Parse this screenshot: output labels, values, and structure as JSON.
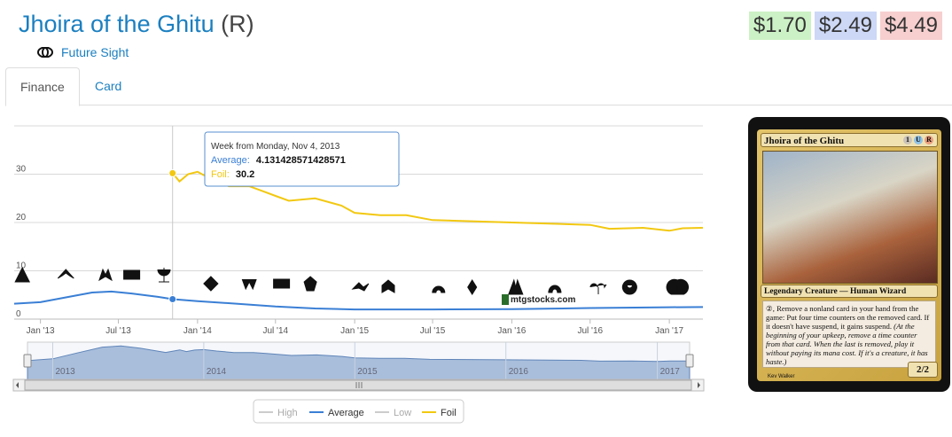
{
  "card": {
    "name": "Jhoira of the Ghitu",
    "rarity": "(R)",
    "set": "Future Sight",
    "set_icon": "future-sight-set-icon",
    "type_line": "Legendary Creature — Human Wizard",
    "rules_text": "②, Remove a nonland card in your hand from the game: Put four time counters on the removed card. If it doesn't have suspend, it gains suspend.",
    "reminder_text": "(At the beginning of your upkeep, remove a time counter from that card. When the last is removed, play it without paying its mana cost. If it's a creature, it has haste.)",
    "pt": "2/2",
    "mana_cost": [
      "1",
      "U",
      "R"
    ],
    "artist": "Kev Walker"
  },
  "prices": [
    "$1.70",
    "$2.49",
    "$4.49"
  ],
  "tabs": [
    {
      "label": "Finance",
      "active": true
    },
    {
      "label": "Card",
      "active": false
    }
  ],
  "chart_data": {
    "type": "line",
    "x_type": "date",
    "xlim": [
      "2012-11-01",
      "2017-03-20"
    ],
    "ylim": [
      0,
      40
    ],
    "yticks": [
      0,
      10,
      20,
      30
    ],
    "xticks": [
      "Jan '13",
      "Jul '13",
      "Jan '14",
      "Jul '14",
      "Jan '15",
      "Jul '15",
      "Jan '16",
      "Jul '16",
      "Jan '17"
    ],
    "xtick_dates": [
      "2013-01-01",
      "2013-07-01",
      "2014-01-01",
      "2014-07-01",
      "2015-01-01",
      "2015-07-01",
      "2016-01-01",
      "2016-07-01",
      "2017-01-01"
    ],
    "grid": true,
    "watermark": "mtgstocks.com",
    "series": [
      {
        "name": "Average",
        "color": "#3a7fd5",
        "points": [
          [
            "2012-11-01",
            3.2
          ],
          [
            "2013-01-01",
            3.5
          ],
          [
            "2013-03-01",
            4.5
          ],
          [
            "2013-05-01",
            5.5
          ],
          [
            "2013-06-15",
            5.7
          ],
          [
            "2013-08-01",
            5.3
          ],
          [
            "2013-10-01",
            4.6
          ],
          [
            "2013-11-04",
            4.13
          ],
          [
            "2014-01-01",
            3.7
          ],
          [
            "2014-04-01",
            3.2
          ],
          [
            "2014-07-01",
            2.6
          ],
          [
            "2014-10-01",
            2.2
          ],
          [
            "2015-01-01",
            2.0
          ],
          [
            "2015-07-01",
            2.0
          ],
          [
            "2016-01-01",
            2.05
          ],
          [
            "2016-07-01",
            2.3
          ],
          [
            "2017-01-01",
            2.45
          ],
          [
            "2017-03-20",
            2.5
          ]
        ]
      },
      {
        "name": "Foil",
        "color": "#f2c811",
        "points": [
          [
            "2013-11-04",
            30.2
          ],
          [
            "2013-11-20",
            28.5
          ],
          [
            "2013-12-10",
            30.0
          ],
          [
            "2014-01-01",
            30.5
          ],
          [
            "2014-02-01",
            29.0
          ],
          [
            "2014-03-15",
            27.5
          ],
          [
            "2014-05-01",
            27.5
          ],
          [
            "2014-06-01",
            26.5
          ],
          [
            "2014-07-01",
            25.5
          ],
          [
            "2014-08-01",
            24.5
          ],
          [
            "2014-10-01",
            25.0
          ],
          [
            "2014-12-01",
            23.5
          ],
          [
            "2015-01-01",
            22.0
          ],
          [
            "2015-03-01",
            21.5
          ],
          [
            "2015-05-01",
            21.5
          ],
          [
            "2015-07-01",
            20.5
          ],
          [
            "2016-01-01",
            20.0
          ],
          [
            "2016-07-01",
            19.5
          ],
          [
            "2016-08-15",
            18.7
          ],
          [
            "2016-11-01",
            18.9
          ],
          [
            "2017-01-01",
            18.3
          ],
          [
            "2017-02-01",
            18.8
          ],
          [
            "2017-03-20",
            18.9
          ]
        ]
      },
      {
        "name": "High",
        "color": "#cccccc",
        "points": []
      },
      {
        "name": "Low",
        "color": "#cccccc",
        "points": []
      }
    ],
    "tooltip": {
      "title": "Week from Monday, Nov 4, 2013",
      "date": "2013-11-04",
      "rows": [
        {
          "label": "Average:",
          "value": "4.131428571428571",
          "color": "#3a7fd5"
        },
        {
          "label": "Foil:",
          "value": "30.2",
          "color": "#f2c811"
        }
      ]
    },
    "navigator": {
      "year_labels": [
        "2013",
        "2014",
        "2015",
        "2016",
        "2017"
      ],
      "year_dates": [
        "2013-01-01",
        "2014-01-01",
        "2015-01-01",
        "2016-01-01",
        "2017-01-01"
      ]
    },
    "legend": [
      "High",
      "Average",
      "Low",
      "Foil"
    ],
    "set_icons": [
      {
        "date": "2012-11-20",
        "icon": "set-icon-1"
      },
      {
        "date": "2013-03-01",
        "icon": "set-icon-2"
      },
      {
        "date": "2013-06-01",
        "icon": "set-icon-3"
      },
      {
        "date": "2013-08-01",
        "icon": "m14-set-icon"
      },
      {
        "date": "2013-10-15",
        "icon": "set-icon-5"
      },
      {
        "date": "2014-02-01",
        "icon": "set-icon-6"
      },
      {
        "date": "2014-05-01",
        "icon": "set-icon-7"
      },
      {
        "date": "2014-07-15",
        "icon": "m15-set-icon"
      },
      {
        "date": "2014-09-20",
        "icon": "set-icon-9"
      },
      {
        "date": "2015-01-15",
        "icon": "set-icon-10"
      },
      {
        "date": "2015-03-20",
        "icon": "set-icon-11"
      },
      {
        "date": "2015-07-15",
        "icon": "set-icon-12"
      },
      {
        "date": "2015-10-01",
        "icon": "set-icon-13"
      },
      {
        "date": "2016-01-10",
        "icon": "set-icon-14"
      },
      {
        "date": "2016-04-10",
        "icon": "set-icon-15"
      },
      {
        "date": "2016-07-20",
        "icon": "set-icon-16"
      },
      {
        "date": "2016-10-01",
        "icon": "set-icon-17"
      },
      {
        "date": "2017-01-20",
        "icon": "set-icon-18"
      }
    ]
  }
}
